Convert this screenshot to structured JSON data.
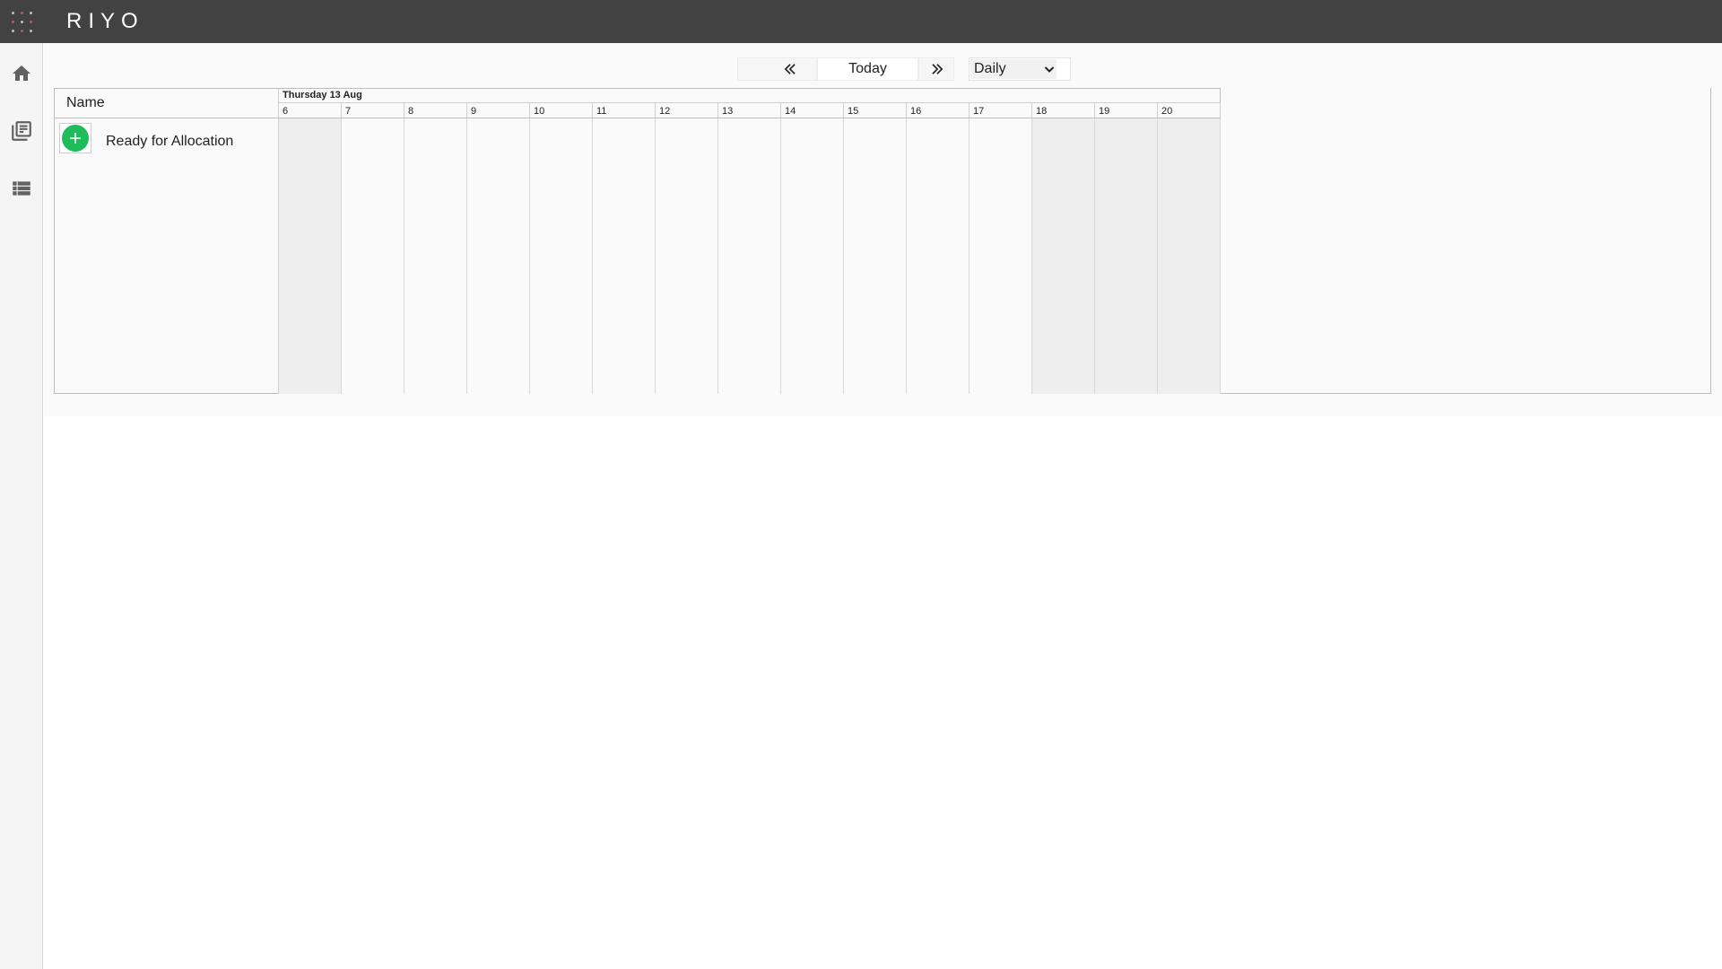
{
  "app": {
    "brand": "RIYO"
  },
  "sidebar": {
    "items": [
      {
        "name": "home",
        "icon": "home-icon"
      },
      {
        "name": "library",
        "icon": "library-books-icon"
      },
      {
        "name": "list",
        "icon": "view-list-icon"
      }
    ]
  },
  "toolbar": {
    "prev_icon": "double-chevron-left-icon",
    "today_label": "Today",
    "next_icon": "double-chevron-right-icon",
    "view_value": "Daily"
  },
  "scheduler": {
    "name_header": "Name",
    "date_label": "Thursday 13 Aug",
    "resources": [
      {
        "name": "Ready for Allocation",
        "action_icon": "add-circle-icon",
        "action_color": "#1ebc5a"
      }
    ],
    "hours": [
      {
        "label": "6",
        "non_working": true
      },
      {
        "label": "7",
        "non_working": false
      },
      {
        "label": "8",
        "non_working": false
      },
      {
        "label": "9",
        "non_working": false
      },
      {
        "label": "10",
        "non_working": false
      },
      {
        "label": "11",
        "non_working": false
      },
      {
        "label": "12",
        "non_working": false
      },
      {
        "label": "13",
        "non_working": false
      },
      {
        "label": "14",
        "non_working": false
      },
      {
        "label": "15",
        "non_working": false
      },
      {
        "label": "16",
        "non_working": false
      },
      {
        "label": "17",
        "non_working": false
      },
      {
        "label": "18",
        "non_working": true
      },
      {
        "label": "19",
        "non_working": true
      },
      {
        "label": "20",
        "non_working": true
      }
    ]
  },
  "colors": {
    "topbar": "#424242",
    "non_working": "#eeeeee",
    "accent_green": "#1ebc5a"
  }
}
